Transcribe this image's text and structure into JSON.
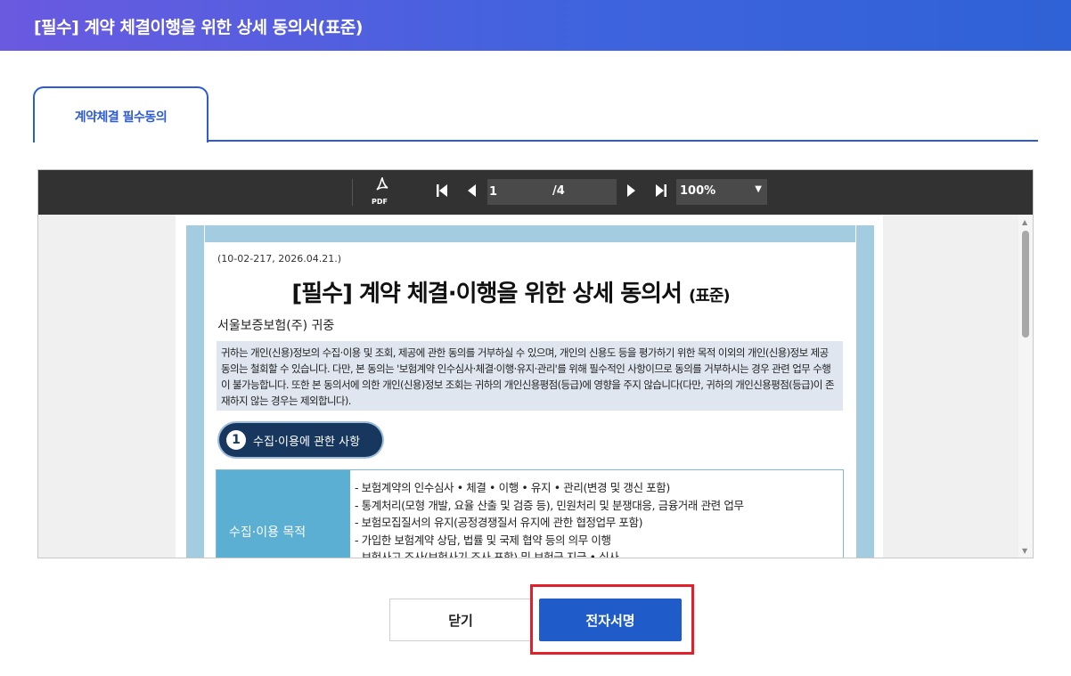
{
  "dialog": {
    "title": "[필수] 계약 체결이행을 위한 상세 동의서(표준)"
  },
  "tabs": [
    {
      "label": "계약체결 필수동의",
      "active": true
    }
  ],
  "viewer": {
    "pdf_label": "PDF",
    "current_page": "1",
    "total_pages": "/4",
    "zoom": "100%"
  },
  "document": {
    "code": "(10-02-217, 2026.04.21.)",
    "title": "[필수] 계약 체결·이행을 위한 상세 동의서",
    "title_suffix": "(표준)",
    "recipient": "서울보증보험(주) 귀중",
    "notice": "귀하는 개인(신용)정보의 수집·이용 및 조회, 제공에 관한 동의를 거부하실 수 있으며, 개인의 신용도 등을 평가하기 위한 목적 이외의 개인(신용)정보 제공 동의는 철회할 수 있습니다. 다만, 본 동의는 '보험계약 인수심사·체결·이행·유지·관리'를 위해 필수적인 사항이므로 동의를 거부하시는 경우 관련 업무 수행이 불가능합니다. 또한 본 동의서에 의한 개인(신용)정보 조회는 귀하의 개인신용평점(등급)에 영향을 주지 않습니다(다만, 귀하의 개인신용평점(등급)이 존재하지 않는 경우는 제외합니다).",
    "section_number": "1",
    "section_title": "수집·이용에 관한 사항",
    "purpose_header": "수집·이용 목적",
    "purposes": [
      "- 보험계약의 인수심사 • 체결 • 이행 • 유지 • 관리(변경 및 갱신 포함)",
      "- 통계처리(모형 개발, 요율 산출 및 검증 등), 민원처리 및 분쟁대응, 금융거래 관련 업무",
      "- 보험모집질서의 유지(공정경쟁질서 유지에 관한 협정업무 포함)",
      "- 가입한 보험계약 상담, 법률 및 국제 협약 등의 의무 이행",
      "- 보험사고 조사(보험사기 조사 포함) 및 보험금 지급 • 심사"
    ]
  },
  "buttons": {
    "close": "닫기",
    "e_sign": "전자서명"
  },
  "colors": {
    "accent": "#1f5bc9",
    "highlight": "#e3202a",
    "toolbar": "#323232"
  }
}
